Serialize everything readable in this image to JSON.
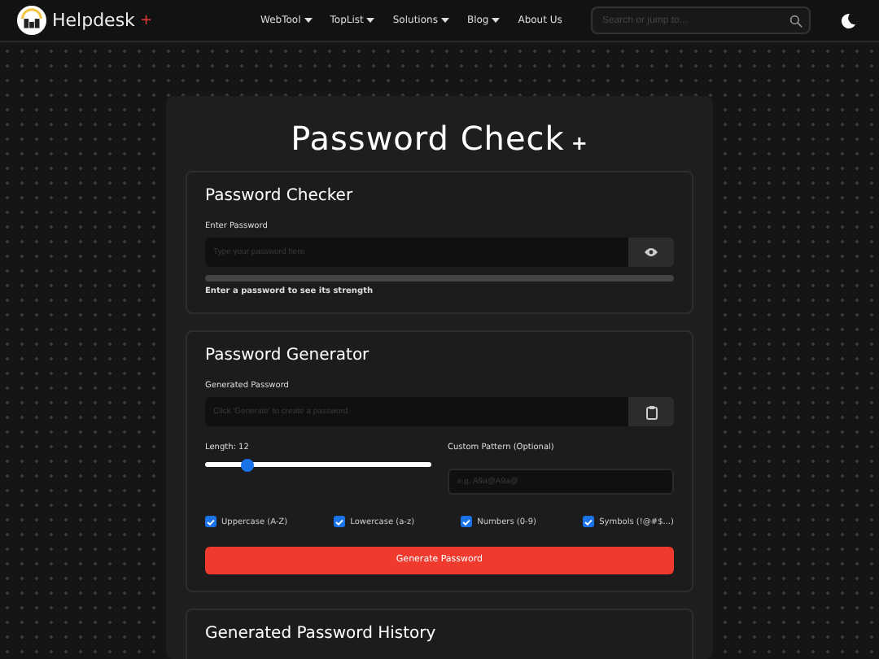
{
  "navbar": {
    "brand": "Helpdesk",
    "brand_mark": "+",
    "menu": [
      {
        "label": "WebTool",
        "dropdown": true
      },
      {
        "label": "TopList",
        "dropdown": true
      },
      {
        "label": "Solutions",
        "dropdown": true
      },
      {
        "label": "Blog",
        "dropdown": true
      },
      {
        "label": "About Us",
        "dropdown": false
      }
    ],
    "search": {
      "placeholder": "Search or jump to..."
    }
  },
  "title": "Password Check",
  "title_mark": "+",
  "checker": {
    "heading": "Password Checker",
    "label": "Enter Password",
    "placeholder": "Type your password here",
    "hint": "Enter a password to see its strength"
  },
  "generator": {
    "heading": "Password Generator",
    "label": "Generated Password",
    "placeholder": "Click 'Generate' to create a password",
    "length_label": "Length: 12",
    "length_slider": {
      "level": 0.19
    },
    "pattern_label": "Custom Pattern (Optional)",
    "pattern_placeholder": "e.g. A9a@A9a@",
    "options": [
      {
        "label": "Uppercase (A-Z)",
        "checked": true
      },
      {
        "label": "Lowercase (a-z)",
        "checked": true
      },
      {
        "label": "Numbers (0-9)",
        "checked": true
      },
      {
        "label": "Symbols (!@#$...)",
        "checked": true
      }
    ],
    "button": "Generate Password"
  },
  "history": {
    "heading": "Generated Password History"
  }
}
